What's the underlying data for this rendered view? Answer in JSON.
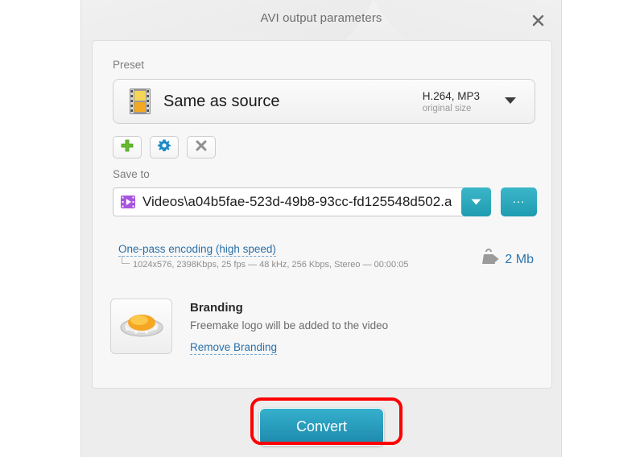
{
  "window": {
    "title": "AVI output parameters",
    "close_icon": "close-icon"
  },
  "preset": {
    "label": "Preset",
    "icon": "film-strip-icon",
    "name": "Same as source",
    "codec": "H.264, MP3",
    "size_note": "original size",
    "caret_icon": "chevron-down-icon"
  },
  "actions": [
    {
      "name": "add-preset-button",
      "icon": "plus-icon"
    },
    {
      "name": "edit-preset-button",
      "icon": "gear-icon"
    },
    {
      "name": "delete-preset-button",
      "icon": "close-x-icon"
    }
  ],
  "save_to": {
    "label": "Save to",
    "file_icon": "video-file-icon",
    "path": "Videos\\a04b5fae-523d-49b8-93cc-fd125548d502.a",
    "dropdown_icon": "chevron-down-icon",
    "browse_label": "...",
    "browse_icon": "ellipsis-icon"
  },
  "encoding": {
    "link": "One-pass encoding (high speed)",
    "details": "1024x576, 2398Kbps, 25 fps — 48 kHz, 256 Kbps, Stereo — 00:00:05",
    "size_icon": "weight-export-icon",
    "size_value": "2 Mb"
  },
  "branding": {
    "thumb_icon": "ufo-logo-icon",
    "title": "Branding",
    "subtitle": "Freemake logo will be added to the video",
    "remove_link": "Remove Branding"
  },
  "footer": {
    "convert_label": "Convert"
  },
  "colors": {
    "accent_teal": "#2196b3",
    "link_blue": "#2a6fa8",
    "highlight_red": "#ff0000",
    "plus_green": "#66bb2e",
    "gear_blue": "#1e8bc8",
    "film_yellow": "#f5c33b",
    "video_purple": "#a855e0",
    "ufo_orange": "#f59a1a"
  }
}
